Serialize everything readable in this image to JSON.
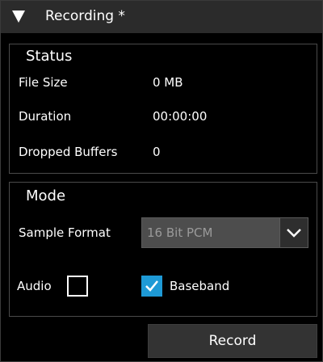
{
  "header": {
    "title": "Recording *",
    "collapse_icon": "triangle-down-icon"
  },
  "status": {
    "legend": "Status",
    "rows": [
      {
        "label": "File Size",
        "value": "0 MB"
      },
      {
        "label": "Duration",
        "value": "00:00:00"
      },
      {
        "label": "Dropped Buffers",
        "value": "0"
      }
    ]
  },
  "mode": {
    "legend": "Mode",
    "sample_format": {
      "label": "Sample Format",
      "selected": "16 Bit PCM",
      "dropdown_icon": "chevron-down-icon"
    },
    "audio": {
      "label": "Audio",
      "checked": false
    },
    "baseband": {
      "label": "Baseband",
      "checked": true,
      "check_icon": "checkmark-icon"
    }
  },
  "actions": {
    "record_label": "Record"
  },
  "colors": {
    "background": "#000000",
    "header": "#2b2b2b",
    "border": "#4a4a4a",
    "select_bg": "#4d4d4d",
    "select_text": "#9a9a9a",
    "check_accent": "#1e9ad6",
    "button": "#333333"
  }
}
